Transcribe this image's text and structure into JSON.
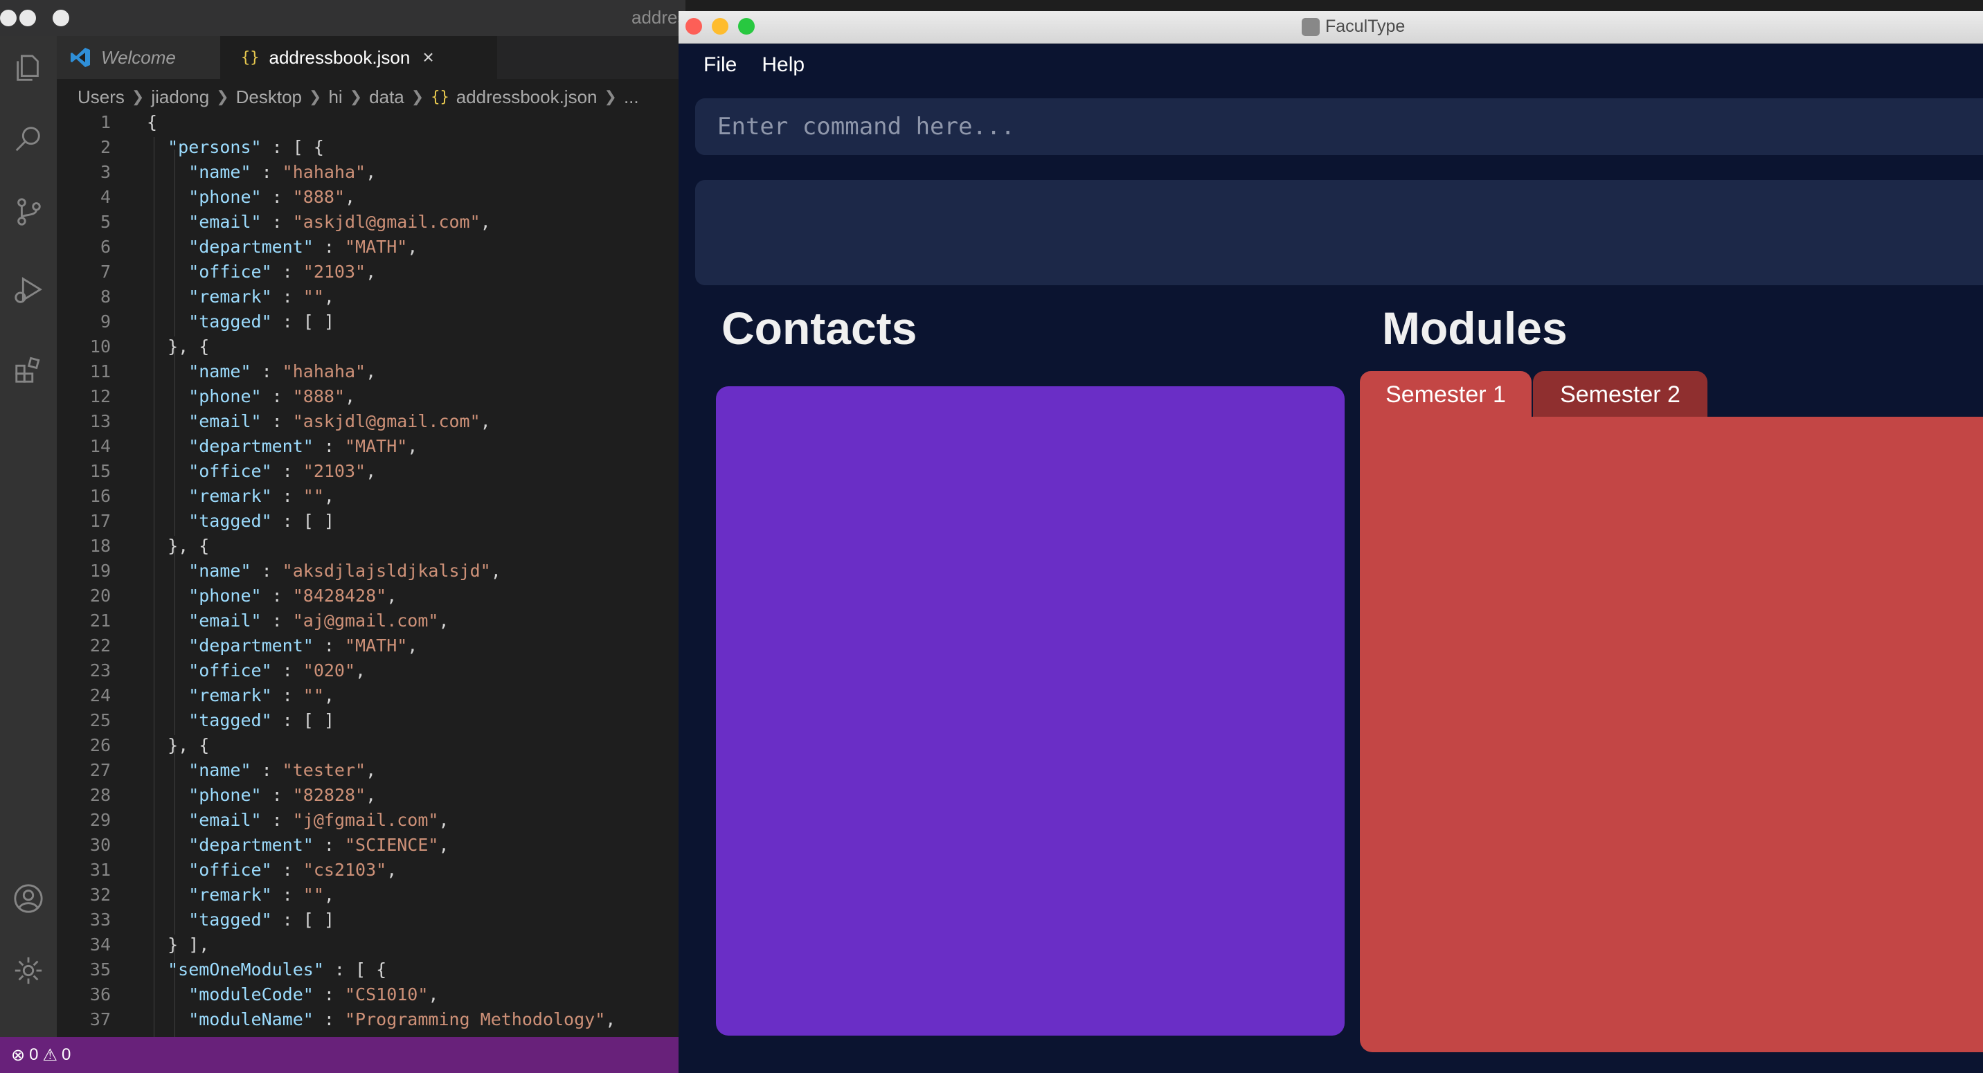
{
  "vscode": {
    "title": "addres",
    "tabs": [
      {
        "label": "Welcome"
      },
      {
        "label": "addressbook.json",
        "close": "×"
      }
    ],
    "breadcrumb": [
      "Users",
      "jiadong",
      "Desktop",
      "hi",
      "data",
      "addressbook.json",
      "..."
    ],
    "status": {
      "errors": "0",
      "warnings": "0"
    }
  },
  "code_lines": [
    {
      "n": "1",
      "t": [
        [
          "p",
          "{"
        ]
      ]
    },
    {
      "n": "2",
      "t": [
        [
          "k",
          "  \"persons\""
        ],
        [
          "p",
          " : [ {"
        ]
      ]
    },
    {
      "n": "3",
      "t": [
        [
          "k",
          "    \"name\""
        ],
        [
          "p",
          " : "
        ],
        [
          "s",
          "\"hahaha\""
        ],
        [
          "p",
          ","
        ]
      ]
    },
    {
      "n": "4",
      "t": [
        [
          "k",
          "    \"phone\""
        ],
        [
          "p",
          " : "
        ],
        [
          "s",
          "\"888\""
        ],
        [
          "p",
          ","
        ]
      ]
    },
    {
      "n": "5",
      "t": [
        [
          "k",
          "    \"email\""
        ],
        [
          "p",
          " : "
        ],
        [
          "s",
          "\"askjdl@gmail.com\""
        ],
        [
          "p",
          ","
        ]
      ]
    },
    {
      "n": "6",
      "t": [
        [
          "k",
          "    \"department\""
        ],
        [
          "p",
          " : "
        ],
        [
          "s",
          "\"MATH\""
        ],
        [
          "p",
          ","
        ]
      ]
    },
    {
      "n": "7",
      "t": [
        [
          "k",
          "    \"office\""
        ],
        [
          "p",
          " : "
        ],
        [
          "s",
          "\"2103\""
        ],
        [
          "p",
          ","
        ]
      ]
    },
    {
      "n": "8",
      "t": [
        [
          "k",
          "    \"remark\""
        ],
        [
          "p",
          " : "
        ],
        [
          "s",
          "\"\""
        ],
        [
          "p",
          ","
        ]
      ]
    },
    {
      "n": "9",
      "t": [
        [
          "k",
          "    \"tagged\""
        ],
        [
          "p",
          " : [ ]"
        ]
      ]
    },
    {
      "n": "10",
      "t": [
        [
          "p",
          "  }, {"
        ]
      ]
    },
    {
      "n": "11",
      "t": [
        [
          "k",
          "    \"name\""
        ],
        [
          "p",
          " : "
        ],
        [
          "s",
          "\"hahaha\""
        ],
        [
          "p",
          ","
        ]
      ]
    },
    {
      "n": "12",
      "t": [
        [
          "k",
          "    \"phone\""
        ],
        [
          "p",
          " : "
        ],
        [
          "s",
          "\"888\""
        ],
        [
          "p",
          ","
        ]
      ]
    },
    {
      "n": "13",
      "t": [
        [
          "k",
          "    \"email\""
        ],
        [
          "p",
          " : "
        ],
        [
          "s",
          "\"askjdl@gmail.com\""
        ],
        [
          "p",
          ","
        ]
      ]
    },
    {
      "n": "14",
      "t": [
        [
          "k",
          "    \"department\""
        ],
        [
          "p",
          " : "
        ],
        [
          "s",
          "\"MATH\""
        ],
        [
          "p",
          ","
        ]
      ]
    },
    {
      "n": "15",
      "t": [
        [
          "k",
          "    \"office\""
        ],
        [
          "p",
          " : "
        ],
        [
          "s",
          "\"2103\""
        ],
        [
          "p",
          ","
        ]
      ]
    },
    {
      "n": "16",
      "t": [
        [
          "k",
          "    \"remark\""
        ],
        [
          "p",
          " : "
        ],
        [
          "s",
          "\"\""
        ],
        [
          "p",
          ","
        ]
      ]
    },
    {
      "n": "17",
      "t": [
        [
          "k",
          "    \"tagged\""
        ],
        [
          "p",
          " : [ ]"
        ]
      ]
    },
    {
      "n": "18",
      "t": [
        [
          "p",
          "  }, {"
        ]
      ]
    },
    {
      "n": "19",
      "t": [
        [
          "k",
          "    \"name\""
        ],
        [
          "p",
          " : "
        ],
        [
          "s",
          "\"aksdjlajsldjkalsjd\""
        ],
        [
          "p",
          ","
        ]
      ]
    },
    {
      "n": "20",
      "t": [
        [
          "k",
          "    \"phone\""
        ],
        [
          "p",
          " : "
        ],
        [
          "s",
          "\"8428428\""
        ],
        [
          "p",
          ","
        ]
      ]
    },
    {
      "n": "21",
      "t": [
        [
          "k",
          "    \"email\""
        ],
        [
          "p",
          " : "
        ],
        [
          "s",
          "\"aj@gmail.com\""
        ],
        [
          "p",
          ","
        ]
      ]
    },
    {
      "n": "22",
      "t": [
        [
          "k",
          "    \"department\""
        ],
        [
          "p",
          " : "
        ],
        [
          "s",
          "\"MATH\""
        ],
        [
          "p",
          ","
        ]
      ]
    },
    {
      "n": "23",
      "t": [
        [
          "k",
          "    \"office\""
        ],
        [
          "p",
          " : "
        ],
        [
          "s",
          "\"020\""
        ],
        [
          "p",
          ","
        ]
      ]
    },
    {
      "n": "24",
      "t": [
        [
          "k",
          "    \"remark\""
        ],
        [
          "p",
          " : "
        ],
        [
          "s",
          "\"\""
        ],
        [
          "p",
          ","
        ]
      ]
    },
    {
      "n": "25",
      "t": [
        [
          "k",
          "    \"tagged\""
        ],
        [
          "p",
          " : [ ]"
        ]
      ]
    },
    {
      "n": "26",
      "t": [
        [
          "p",
          "  }, {"
        ]
      ]
    },
    {
      "n": "27",
      "t": [
        [
          "k",
          "    \"name\""
        ],
        [
          "p",
          " : "
        ],
        [
          "s",
          "\"tester\""
        ],
        [
          "p",
          ","
        ]
      ]
    },
    {
      "n": "28",
      "t": [
        [
          "k",
          "    \"phone\""
        ],
        [
          "p",
          " : "
        ],
        [
          "s",
          "\"82828\""
        ],
        [
          "p",
          ","
        ]
      ]
    },
    {
      "n": "29",
      "t": [
        [
          "k",
          "    \"email\""
        ],
        [
          "p",
          " : "
        ],
        [
          "s",
          "\"j@fgmail.com\""
        ],
        [
          "p",
          ","
        ]
      ]
    },
    {
      "n": "30",
      "t": [
        [
          "k",
          "    \"department\""
        ],
        [
          "p",
          " : "
        ],
        [
          "s",
          "\"SCIENCE\""
        ],
        [
          "p",
          ","
        ]
      ]
    },
    {
      "n": "31",
      "t": [
        [
          "k",
          "    \"office\""
        ],
        [
          "p",
          " : "
        ],
        [
          "s",
          "\"cs2103\""
        ],
        [
          "p",
          ","
        ]
      ]
    },
    {
      "n": "32",
      "t": [
        [
          "k",
          "    \"remark\""
        ],
        [
          "p",
          " : "
        ],
        [
          "s",
          "\"\""
        ],
        [
          "p",
          ","
        ]
      ]
    },
    {
      "n": "33",
      "t": [
        [
          "k",
          "    \"tagged\""
        ],
        [
          "p",
          " : [ ]"
        ]
      ]
    },
    {
      "n": "34",
      "t": [
        [
          "p",
          "  } ],"
        ]
      ]
    },
    {
      "n": "35",
      "t": [
        [
          "k",
          "  \"semOneModules\""
        ],
        [
          "p",
          " : [ {"
        ]
      ]
    },
    {
      "n": "36",
      "t": [
        [
          "k",
          "    \"moduleCode\""
        ],
        [
          "p",
          " : "
        ],
        [
          "s",
          "\"CS1010\""
        ],
        [
          "p",
          ","
        ]
      ]
    },
    {
      "n": "37",
      "t": [
        [
          "k",
          "    \"moduleName\""
        ],
        [
          "p",
          " : "
        ],
        [
          "s",
          "\"Programming Methodology\""
        ],
        [
          "p",
          ","
        ]
      ]
    }
  ],
  "app": {
    "title": "FaculType",
    "menu": [
      "File",
      "Help"
    ],
    "command_placeholder": "Enter command here...",
    "contacts_title": "Contacts",
    "modules_title": "Modules",
    "semester_tabs": [
      "Semester 1",
      "Semester 2"
    ]
  },
  "colors": {
    "app_bg": "#0b1430",
    "contacts_panel": "#6a2ec6",
    "modules_panel": "#c34645",
    "semester_tab_active": "#c34645",
    "semester_tab_inactive": "#8f2f2f",
    "status_bar": "#68217a"
  }
}
